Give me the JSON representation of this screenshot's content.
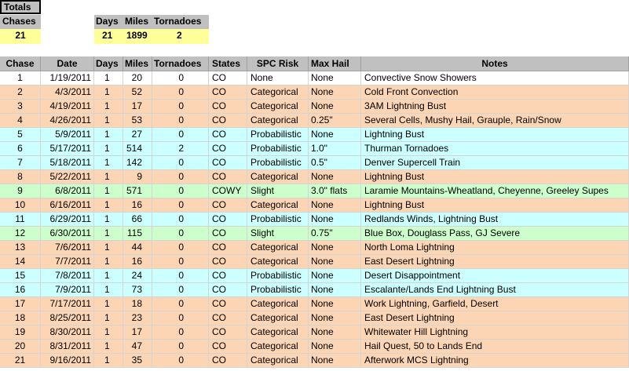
{
  "totals": {
    "title": "Totals",
    "labels": {
      "chases": "Chases",
      "days": "Days",
      "miles": "Miles",
      "tornadoes": "Tornadoes"
    },
    "values": {
      "chases": "21",
      "days": "21",
      "miles": "1899",
      "tornadoes": "2"
    }
  },
  "columns": [
    "Chase",
    "Date",
    "Days",
    "Miles",
    "Tornadoes",
    "States",
    "SPC Risk",
    "Max Hail",
    "Notes"
  ],
  "rows": [
    {
      "color": "white",
      "cells": [
        "1",
        "1/19/2011",
        "1",
        "20",
        "0",
        "CO",
        "None",
        "None",
        "Convective Snow Showers"
      ]
    },
    {
      "color": "orange",
      "cells": [
        "2",
        "4/3/2011",
        "1",
        "52",
        "0",
        "CO",
        "Categorical",
        "None",
        "Cold Front Convection"
      ]
    },
    {
      "color": "orange",
      "cells": [
        "3",
        "4/19/2011",
        "1",
        "17",
        "0",
        "CO",
        "Categorical",
        "None",
        "3AM Lightning Bust"
      ]
    },
    {
      "color": "orange",
      "cells": [
        "4",
        "4/26/2011",
        "1",
        "53",
        "0",
        "CO",
        "Categorical",
        "0.25\"",
        "Several Cells, Mushy Hail, Grauple, Rain/Snow"
      ]
    },
    {
      "color": "blue",
      "cells": [
        "5",
        "5/9/2011",
        "1",
        "27",
        "0",
        "CO",
        "Probabilistic",
        "None",
        "Lightning Bust"
      ]
    },
    {
      "color": "blue",
      "cells": [
        "6",
        "5/17/2011",
        "1",
        "514",
        "2",
        "CO",
        "Probabilistic",
        "1.0\"",
        "Thurman Tornadoes"
      ]
    },
    {
      "color": "blue",
      "cells": [
        "7",
        "5/18/2011",
        "1",
        "142",
        "0",
        "CO",
        "Probabilistic",
        "0.5\"",
        "Denver Supercell Train"
      ]
    },
    {
      "color": "orange",
      "cells": [
        "8",
        "5/22/2011",
        "1",
        "9",
        "0",
        "CO",
        "Categorical",
        "None",
        "Lightning Bust"
      ]
    },
    {
      "color": "green",
      "cells": [
        "9",
        "6/8/2011",
        "1",
        "571",
        "0",
        "COWY",
        "Slight",
        "3.0\" flats",
        "Laramie Mountains-Wheatland, Cheyenne, Greeley Supes"
      ]
    },
    {
      "color": "orange",
      "cells": [
        "10",
        "6/16/2011",
        "1",
        "16",
        "0",
        "CO",
        "Categorical",
        "None",
        "Lightning Bust"
      ]
    },
    {
      "color": "blue",
      "cells": [
        "11",
        "6/29/2011",
        "1",
        "66",
        "0",
        "CO",
        "Probabilistic",
        "None",
        "Redlands Winds, Lightning Bust"
      ]
    },
    {
      "color": "green",
      "cells": [
        "12",
        "6/30/2011",
        "1",
        "115",
        "0",
        "CO",
        "Slight",
        "0.75\"",
        "Blue Box, Douglass Pass, GJ Severe"
      ]
    },
    {
      "color": "orange",
      "cells": [
        "13",
        "7/6/2011",
        "1",
        "44",
        "0",
        "CO",
        "Categorical",
        "None",
        "North Loma Lightning"
      ]
    },
    {
      "color": "orange",
      "cells": [
        "14",
        "7/7/2011",
        "1",
        "16",
        "0",
        "CO",
        "Categorical",
        "None",
        "East Desert Lightning"
      ]
    },
    {
      "color": "blue",
      "cells": [
        "15",
        "7/8/2011",
        "1",
        "24",
        "0",
        "CO",
        "Probabilistic",
        "None",
        "Desert Disappointment"
      ]
    },
    {
      "color": "blue",
      "cells": [
        "16",
        "7/9/2011",
        "1",
        "73",
        "0",
        "CO",
        "Probabilistic",
        "None",
        "Escalante/Lands End Lightning Bust"
      ]
    },
    {
      "color": "orange",
      "cells": [
        "17",
        "7/17/2011",
        "1",
        "18",
        "0",
        "CO",
        "Categorical",
        "None",
        "Work Lightning, Garfield, Desert"
      ]
    },
    {
      "color": "orange",
      "cells": [
        "18",
        "8/25/2011",
        "1",
        "23",
        "0",
        "CO",
        "Categorical",
        "None",
        "East Desert Lightning"
      ]
    },
    {
      "color": "orange",
      "cells": [
        "19",
        "8/30/2011",
        "1",
        "17",
        "0",
        "CO",
        "Categorical",
        "None",
        "Whitewater Hill Lightning"
      ]
    },
    {
      "color": "orange",
      "cells": [
        "20",
        "8/31/2011",
        "1",
        "47",
        "0",
        "CO",
        "Categorical",
        "None",
        "Hail Quest, 50 to Lands End"
      ]
    },
    {
      "color": "orange",
      "cells": [
        "21",
        "9/16/2011",
        "1",
        "35",
        "0",
        "CO",
        "Categorical",
        "None",
        "Afterwork MCS Lightning"
      ]
    }
  ],
  "colors": {
    "white": "#ffffff",
    "orange": "#fcd5b4",
    "blue": "#ccffff",
    "green": "#ccffcc",
    "header": "#c0c0c0",
    "totals": "#ffff99"
  }
}
